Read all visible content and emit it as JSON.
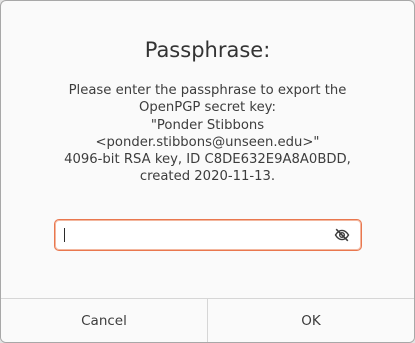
{
  "dialog": {
    "title": "Passphrase:",
    "message_lines": [
      "Please enter the passphrase to export the",
      "OpenPGP secret key:",
      "\"Ponder Stibbons",
      "<ponder.stibbons@unseen.edu>\"",
      "4096-bit RSA key, ID C8DE632E9A8A0BDD,",
      "created 2020-11-13."
    ],
    "passphrase_input": {
      "value": "",
      "visibility_icon": "eye-hidden-icon"
    },
    "buttons": {
      "cancel_label": "Cancel",
      "ok_label": "OK"
    }
  },
  "colors": {
    "focus_border": "#e9774e",
    "background": "#fafafa"
  }
}
